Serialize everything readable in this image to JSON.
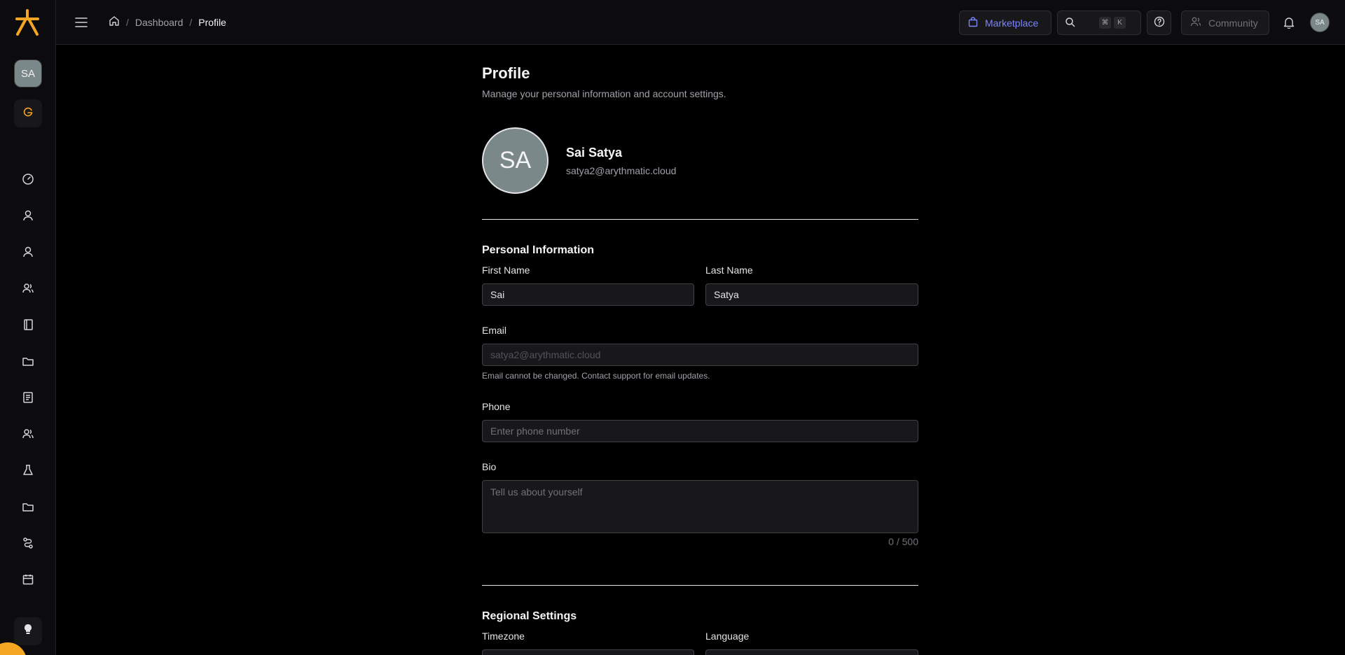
{
  "sidebar": {
    "avatar_initials": "SA",
    "nav_icons": [
      "dashboard-icon",
      "user-icon",
      "user-icon",
      "users-icon",
      "book-icon",
      "folder-icon",
      "report-icon",
      "users-icon",
      "flask-icon",
      "folder-icon",
      "route-icon",
      "calendar-icon"
    ]
  },
  "header": {
    "breadcrumb": [
      "Dashboard",
      "Profile"
    ],
    "marketplace_label": "Marketplace",
    "kbd_cmd": "⌘",
    "kbd_k": "K",
    "community_label": "Community",
    "avatar_initials": "SA"
  },
  "profile": {
    "title": "Profile",
    "subtitle": "Manage your personal information and account settings.",
    "avatar_initials": "SA",
    "name": "Sai Satya",
    "email": "satya2@arythmatic.cloud"
  },
  "personal": {
    "title": "Personal Information",
    "first_name_label": "First Name",
    "first_name_value": "Sai",
    "last_name_label": "Last Name",
    "last_name_value": "Satya",
    "email_label": "Email",
    "email_value": "satya2@arythmatic.cloud",
    "email_hint": "Email cannot be changed. Contact support for email updates.",
    "phone_label": "Phone",
    "phone_placeholder": "Enter phone number",
    "bio_label": "Bio",
    "bio_placeholder": "Tell us about yourself",
    "bio_counter": "0 / 500"
  },
  "regional": {
    "title": "Regional Settings",
    "timezone_label": "Timezone",
    "language_label": "Language"
  },
  "colors": {
    "accent": "#f5a623",
    "marketplace": "#7c83ff",
    "avatar": "#7b8889"
  }
}
